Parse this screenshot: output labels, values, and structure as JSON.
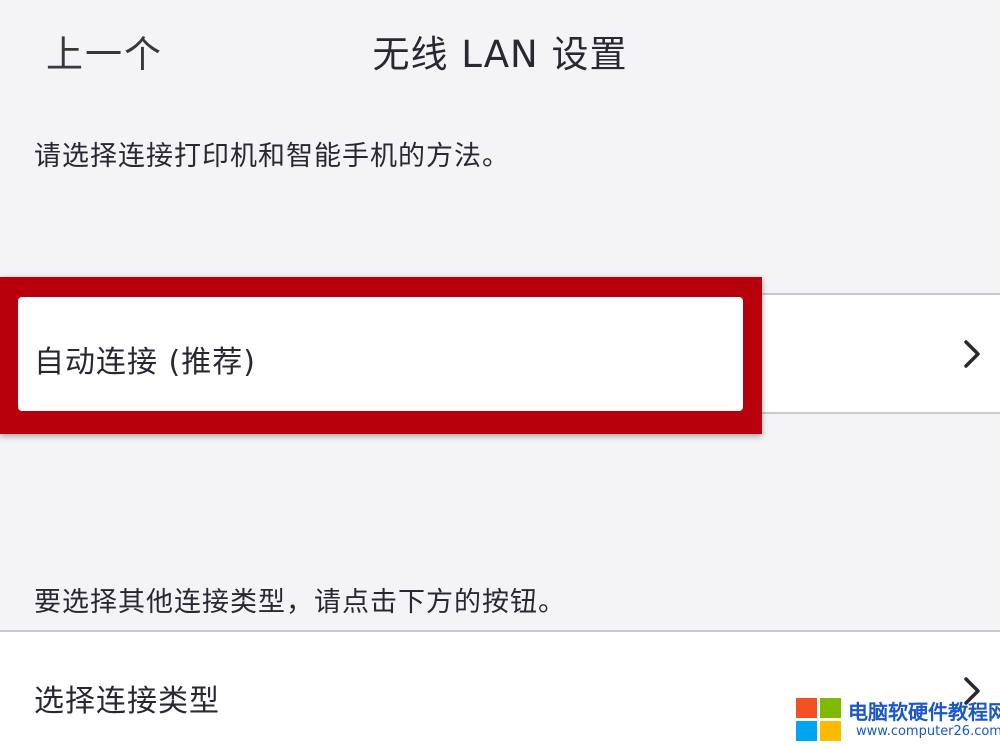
{
  "nav": {
    "back_label": "上一个",
    "title": "无线 LAN 设置"
  },
  "main": {
    "description": "请选择连接打印机和智能手机的方法。",
    "auto_connect_label": "自动连接 (推荐)",
    "other_types_description": "要选择其他连接类型，请点击下方的按钮。",
    "select_type_label": "选择连接类型"
  },
  "icons": {
    "row_chevron": "chevron-right-icon",
    "watermark_logo": "windows-logo-icon"
  },
  "colors": {
    "highlight": "#b8000c",
    "background": "#f4f4f6",
    "watermark_text": "#1b57c7"
  },
  "watermark": {
    "site_name": "电脑软硬件教程网",
    "url": "www.computer26.com"
  }
}
